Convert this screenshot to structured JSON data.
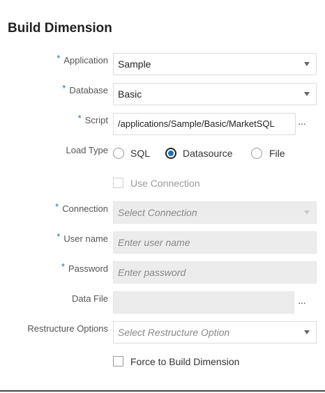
{
  "title": "Build Dimension",
  "required_marker": "*",
  "application": {
    "label": "Application",
    "value": "Sample"
  },
  "database": {
    "label": "Database",
    "value": "Basic"
  },
  "script": {
    "label": "Script",
    "value": "/applications/Sample/Basic/MarketSQL",
    "browse": "···"
  },
  "load_type": {
    "label": "Load Type",
    "options": [
      "SQL",
      "Datasource",
      "File"
    ],
    "selected": "Datasource"
  },
  "use_connection": {
    "label": "Use Connection",
    "checked": false
  },
  "connection": {
    "label": "Connection",
    "placeholder": "Select Connection"
  },
  "user_name": {
    "label": "User name",
    "placeholder": "Enter user name"
  },
  "password": {
    "label": "Password",
    "placeholder": "Enter password"
  },
  "data_file": {
    "label": "Data File",
    "value": "",
    "browse": "···"
  },
  "restructure": {
    "label": "Restructure Options",
    "placeholder": "Select Restructure Option"
  },
  "force_build": {
    "label": "Force to Build Dimension",
    "checked": false
  },
  "colors": {
    "accent": "#1a6fbd",
    "disabled_bg": "#ececec"
  }
}
